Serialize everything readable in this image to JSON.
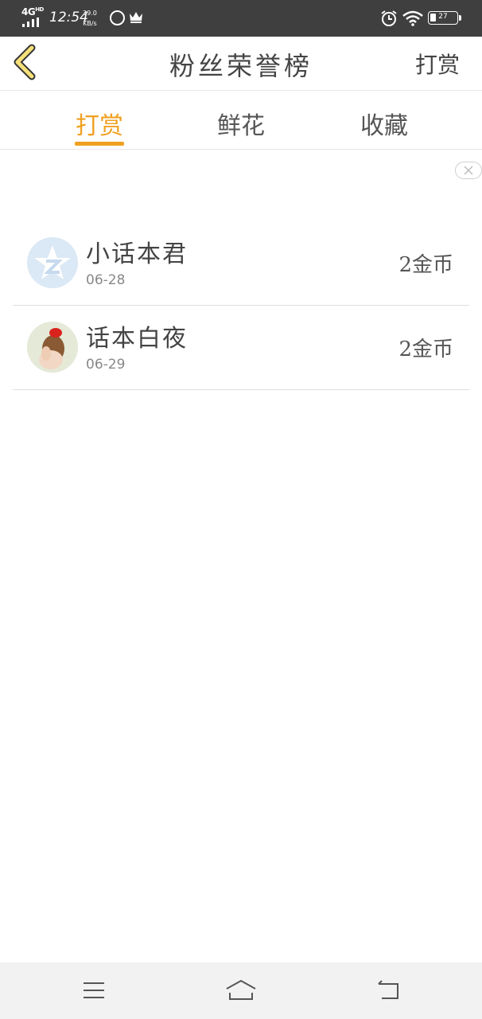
{
  "status_bar": {
    "network": "4G",
    "network_sup": "HD",
    "time": "12:54",
    "speed_value": "39.0",
    "speed_unit": "KB/s",
    "battery": "27",
    "icons": [
      "signal-icon",
      "app-notification-icon",
      "crown-icon",
      "alarm-icon",
      "wifi-icon",
      "battery-icon"
    ]
  },
  "header": {
    "title": "粉丝荣誉榜",
    "action_label": "打赏",
    "back_icon": "chevron-left-icon"
  },
  "tabs": [
    {
      "label": "打赏",
      "active": true
    },
    {
      "label": "鲜花",
      "active": false
    },
    {
      "label": "收藏",
      "active": false
    }
  ],
  "accent_color": "#f0a020",
  "list": [
    {
      "name": "小话本君",
      "date": "06-28",
      "amount": "2金币",
      "avatar": "qq-logo-avatar"
    },
    {
      "name": "话本白夜",
      "date": "06-29",
      "amount": "2金币",
      "avatar": "girl-photo-avatar"
    }
  ],
  "nav_bar": {
    "icons": [
      "menu-icon",
      "home-icon",
      "back-icon"
    ]
  }
}
